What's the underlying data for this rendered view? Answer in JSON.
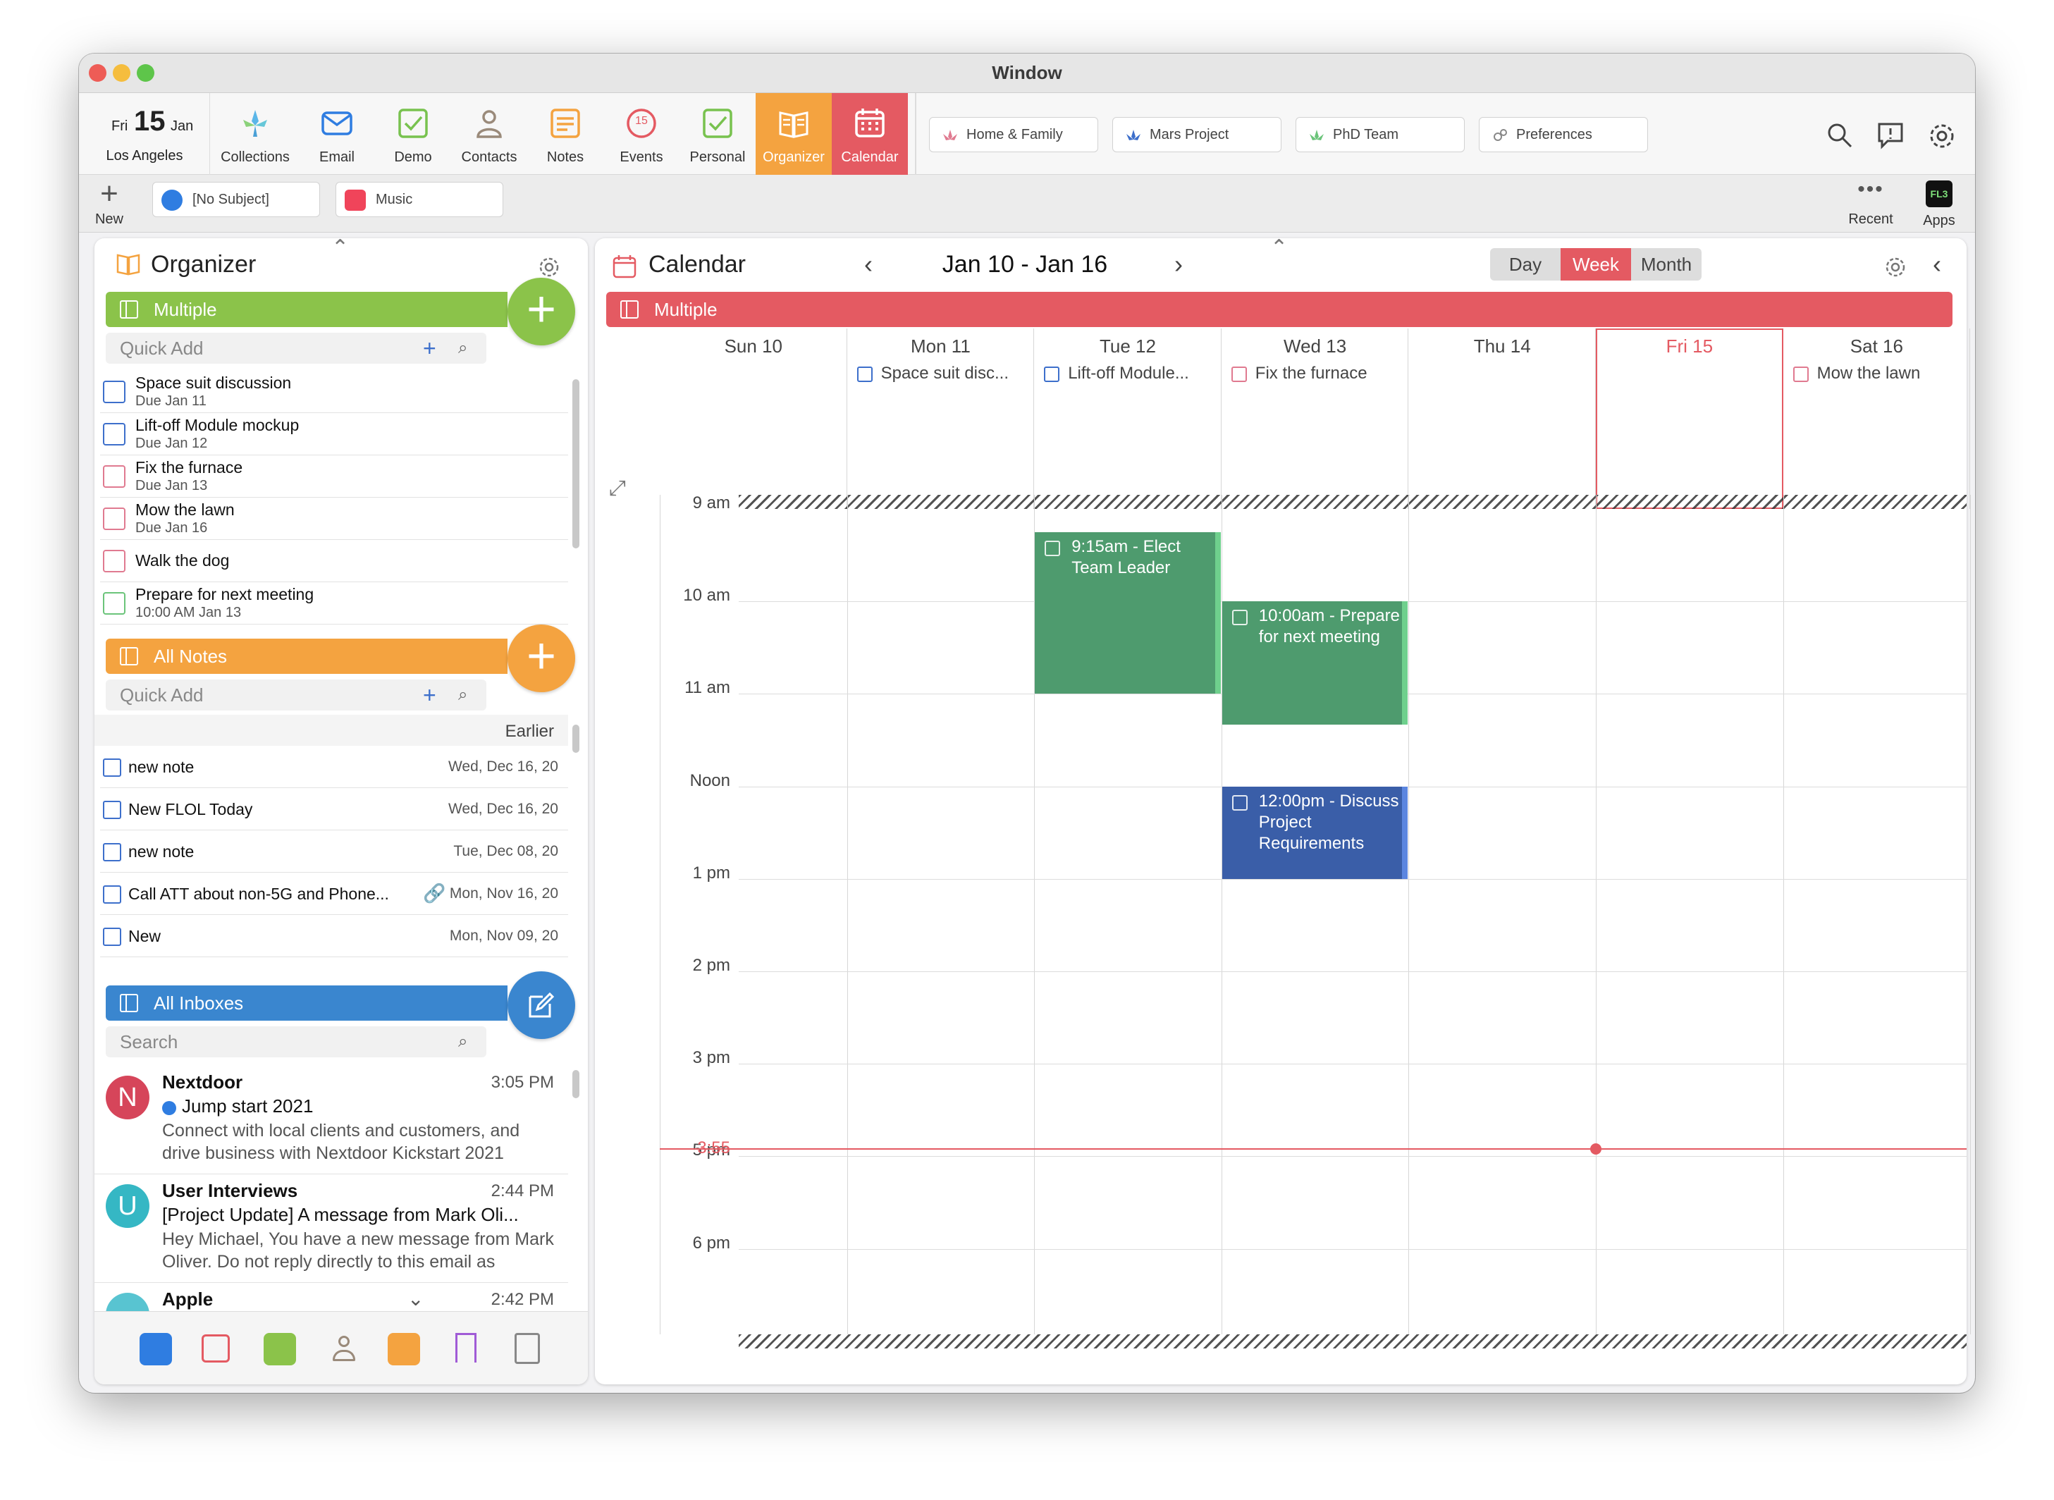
{
  "window": {
    "title": "Window"
  },
  "date_widget": {
    "weekday": "Fri",
    "day": "15",
    "month": "Jan",
    "location": "Los Angeles"
  },
  "toolbar": {
    "items": [
      {
        "label": "Collections",
        "icon": "collections-icon"
      },
      {
        "label": "Email",
        "icon": "email-icon"
      },
      {
        "label": "Demo",
        "icon": "demo-checkbox-icon"
      },
      {
        "label": "Contacts",
        "icon": "contacts-icon"
      },
      {
        "label": "Notes",
        "icon": "notes-icon"
      },
      {
        "label": "Events",
        "icon": "events-icon",
        "badge": "15"
      },
      {
        "label": "Personal",
        "icon": "personal-checkbox-icon"
      },
      {
        "label": "Organizer",
        "icon": "organizer-icon"
      },
      {
        "label": "Calendar",
        "icon": "calendar-icon"
      }
    ],
    "workspaces": [
      "Home & Family",
      "Mars Project",
      "PhD Team",
      "Preferences"
    ]
  },
  "subbar": {
    "new_label": "New",
    "tabs": [
      "[No Subject]",
      "Music"
    ],
    "recent_label": "Recent",
    "apps_label": "Apps",
    "apps_badge": "FL3"
  },
  "organizer": {
    "title": "Organizer",
    "tasks_bar": "Multiple",
    "quick_add_placeholder": "Quick Add",
    "tasks": [
      {
        "title": "Space suit discussion",
        "due": "Due Jan 11",
        "color": "#3d6fcb"
      },
      {
        "title": "Lift-off Module mockup",
        "due": "Due Jan 12",
        "color": "#3d6fcb"
      },
      {
        "title": "Fix the furnace",
        "due": "Due Jan 13",
        "color": "#e07a90"
      },
      {
        "title": "Mow the lawn",
        "due": "Due Jan 16",
        "color": "#e07a90"
      },
      {
        "title": "Walk the dog",
        "due": "",
        "color": "#e07a90"
      },
      {
        "title": "Prepare for next meeting",
        "due": "10:00 AM Jan 13",
        "color": "#6bc47a"
      }
    ],
    "notes_bar": "All Notes",
    "notes_group": "Earlier",
    "notes": [
      {
        "title": "new note",
        "date": "Wed, Dec 16, 20"
      },
      {
        "title": "New FLOL Today",
        "date": "Wed, Dec 16, 20"
      },
      {
        "title": "new note",
        "date": "Tue, Dec 08, 20"
      },
      {
        "title": "Call ATT about non-5G and Phone...",
        "date": "Mon, Nov 16, 20"
      },
      {
        "title": "New",
        "date": "Mon, Nov 09, 20"
      }
    ],
    "inbox_bar": "All Inboxes",
    "search_placeholder": "Search",
    "mails": [
      {
        "initial": "N",
        "from": "Nextdoor",
        "time": "3:05 PM",
        "subject": "Jump start 2021",
        "preview": "Connect with local clients and customers, and drive business with Nextdoor Kickstart 2021",
        "avatar_color": "#d6455a"
      },
      {
        "initial": "U",
        "from": "User Interviews",
        "time": "2:44 PM",
        "subject": "[Project Update] A message from Mark Oli...",
        "preview": "Hey Michael, You have a new message from Mark Oliver. Do not reply directly to this email as",
        "avatar_color": "#35b7c4"
      },
      {
        "initial": "",
        "from": "Apple",
        "time": "2:42 PM",
        "subject": "",
        "preview": "",
        "avatar_color": "#58c4d1"
      }
    ]
  },
  "calendar": {
    "title": "Calendar",
    "range": "Jan 10 - Jan 16",
    "views": [
      "Day",
      "Week",
      "Month"
    ],
    "selected_view": "Week",
    "bar": "Multiple",
    "days": [
      "Sun 10",
      "Mon 11",
      "Tue 12",
      "Wed 13",
      "Thu 14",
      "Fri 15",
      "Sat 16"
    ],
    "today": "Fri 15",
    "all_day": [
      {
        "day": "Mon 11",
        "title": "Space suit disc...",
        "color": "#3d6fcb"
      },
      {
        "day": "Tue 12",
        "title": "Lift-off Module...",
        "color": "#3d6fcb"
      },
      {
        "day": "Wed 13",
        "title": "Fix the furnace",
        "color": "#e07a90"
      },
      {
        "day": "Sat 16",
        "title": "Mow the lawn",
        "color": "#e07a90"
      }
    ],
    "hours": [
      "9 am",
      "10 am",
      "11 am",
      "Noon",
      "1 pm",
      "2 pm",
      "3 pm",
      "3:55",
      "5 pm",
      "6 pm"
    ],
    "events": [
      {
        "title": "9:15am - Elect Team Leader",
        "color": "#4e9b6e"
      },
      {
        "title": "10:00am - Prepare for next meeting",
        "color": "#4e9b6e"
      },
      {
        "title": "12:00pm - Discuss Project Requirements",
        "color": "#3a5ea8"
      }
    ]
  },
  "colors": {
    "green": "#8bc34a",
    "orange": "#f4a340",
    "blue": "#3a86cf",
    "red": "#e45a62",
    "organizer_sel": "#f4a340",
    "calendar_sel": "#e45a62"
  }
}
